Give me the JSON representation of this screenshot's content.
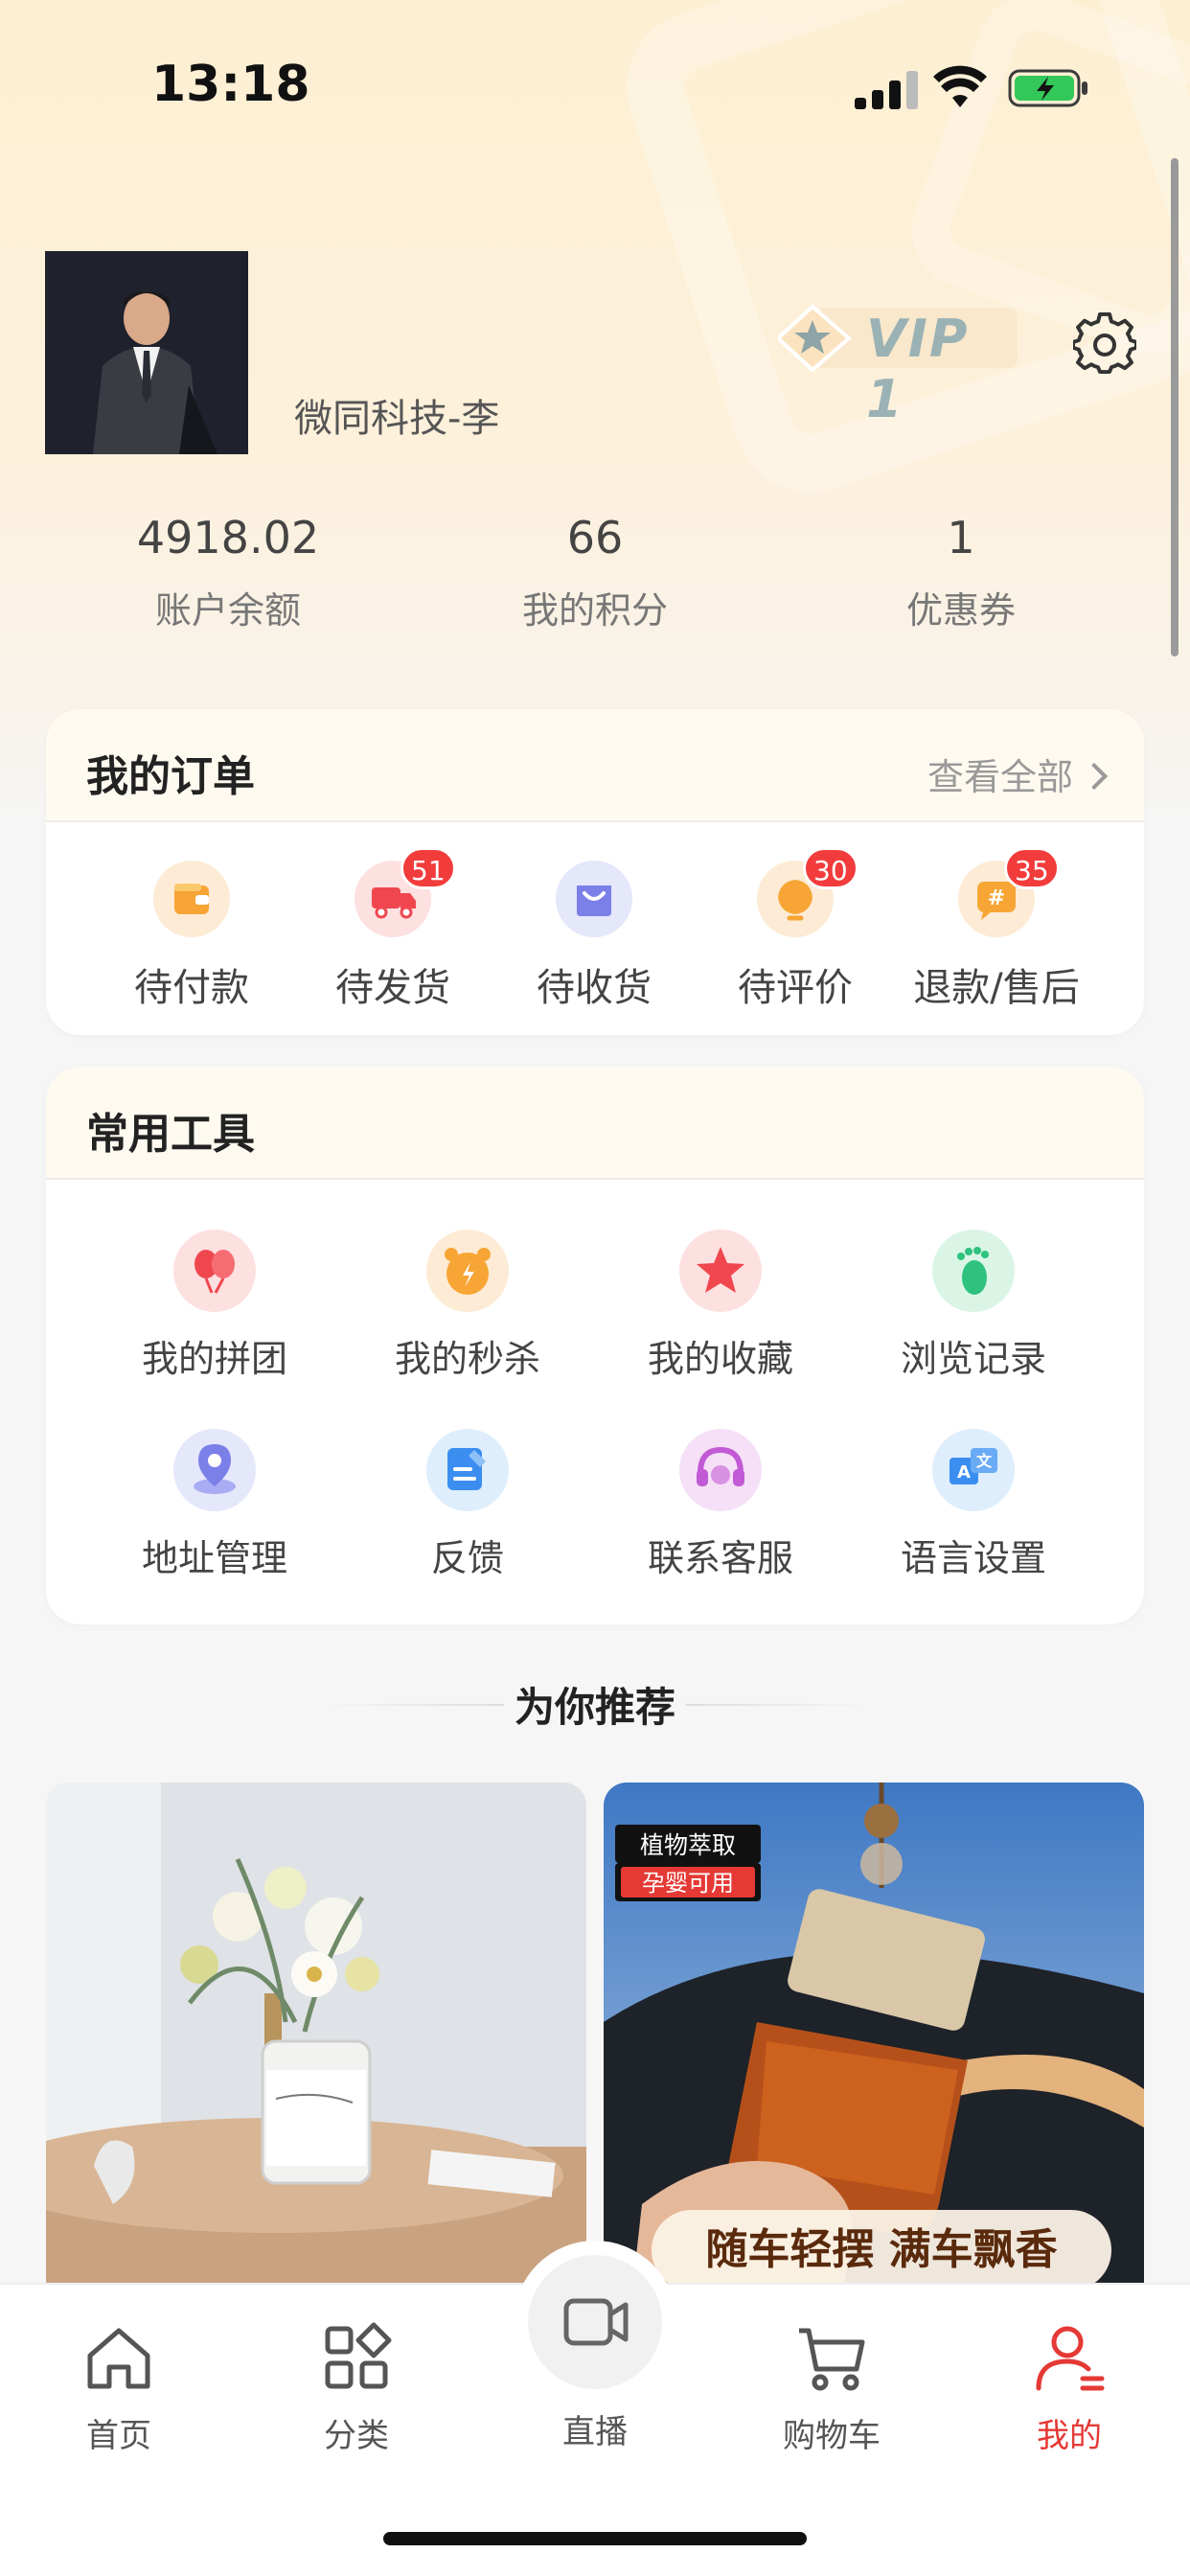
{
  "status_bar": {
    "time": "13:18"
  },
  "profile": {
    "username": "微同科技-李",
    "vip_label": "VIP 1"
  },
  "stats": [
    {
      "value": "4918.02",
      "label": "账户余额"
    },
    {
      "value": "66",
      "label": "我的积分"
    },
    {
      "value": "1",
      "label": "优惠券"
    }
  ],
  "orders": {
    "title": "我的订单",
    "see_all": "查看全部",
    "items": [
      {
        "label": "待付款",
        "badge": "",
        "icon": "wallet-icon"
      },
      {
        "label": "待发货",
        "badge": "51",
        "icon": "truck-icon"
      },
      {
        "label": "待收货",
        "badge": "",
        "icon": "box-icon"
      },
      {
        "label": "待评价",
        "badge": "30",
        "icon": "review-icon"
      },
      {
        "label": "退款/售后",
        "badge": "35",
        "icon": "refund-icon"
      }
    ]
  },
  "tools": {
    "title": "常用工具",
    "items": [
      {
        "label": "我的拼团",
        "icon": "balloons-icon"
      },
      {
        "label": "我的秒杀",
        "icon": "alarm-icon"
      },
      {
        "label": "我的收藏",
        "icon": "star-icon"
      },
      {
        "label": "浏览记录",
        "icon": "footprint-icon"
      },
      {
        "label": "地址管理",
        "icon": "location-icon"
      },
      {
        "label": "反馈",
        "icon": "feedback-icon"
      },
      {
        "label": "联系客服",
        "icon": "headset-icon"
      },
      {
        "label": "语言设置",
        "icon": "language-icon"
      }
    ]
  },
  "recommend": {
    "title": "为你推荐",
    "products": [
      {
        "tag": "",
        "subtag": "",
        "banner": ""
      },
      {
        "tag": "植物萃取",
        "subtag": "孕婴可用",
        "banner": "随车轻摆 满车飘香"
      }
    ]
  },
  "tabbar": {
    "items": [
      {
        "label": "首页",
        "icon": "home-icon"
      },
      {
        "label": "分类",
        "icon": "category-icon"
      },
      {
        "label": "直播",
        "icon": "video-camera-icon"
      },
      {
        "label": "购物车",
        "icon": "cart-icon"
      },
      {
        "label": "我的",
        "icon": "user-icon"
      }
    ],
    "active_index": 4,
    "active_color": "#e53935"
  }
}
